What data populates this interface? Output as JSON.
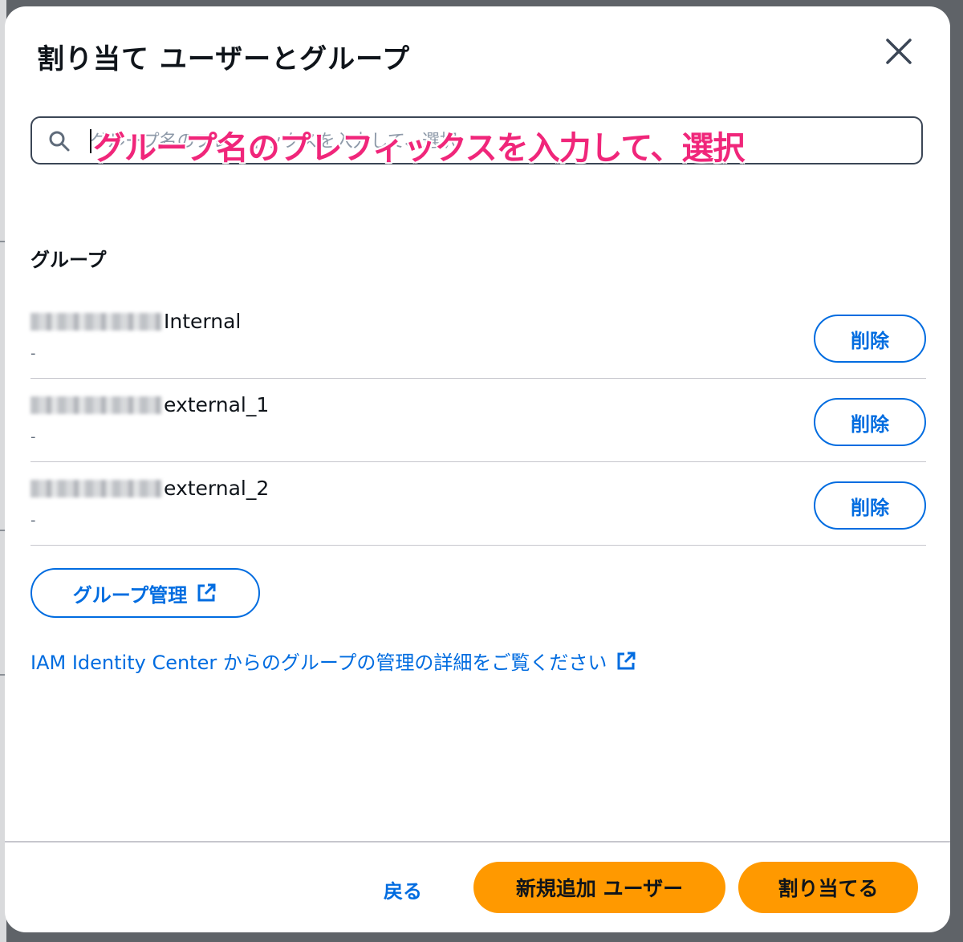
{
  "dialog": {
    "title": "割り当て ユーザーとグループ",
    "close_icon": "close-icon"
  },
  "search": {
    "icon": "search-icon",
    "placeholder": "グループ名のプレフィックスを入力して、選択"
  },
  "annotation": {
    "text": "グループ名のプレフィックスを入力して、選択",
    "color": "#f0267a"
  },
  "groups": {
    "heading": "グループ",
    "items": [
      {
        "name_suffix": "Internal",
        "description": "-",
        "remove_label": "削除"
      },
      {
        "name_suffix": "external_1",
        "description": "-",
        "remove_label": "削除"
      },
      {
        "name_suffix": "external_2",
        "description": "-",
        "remove_label": "削除"
      }
    ]
  },
  "manage_groups": {
    "label": "グループ管理",
    "icon": "external-link-icon"
  },
  "learn_more": {
    "label": "IAM Identity Center からのグループの管理の詳細をご覧ください",
    "icon": "external-link-icon"
  },
  "footer": {
    "back_label": "戻る",
    "new_user_label": "新規追加 ユーザー",
    "assign_label": "割り当てる"
  },
  "colors": {
    "accent": "#006ce0",
    "primary_button": "#ff9900",
    "annotation": "#f0267a"
  }
}
